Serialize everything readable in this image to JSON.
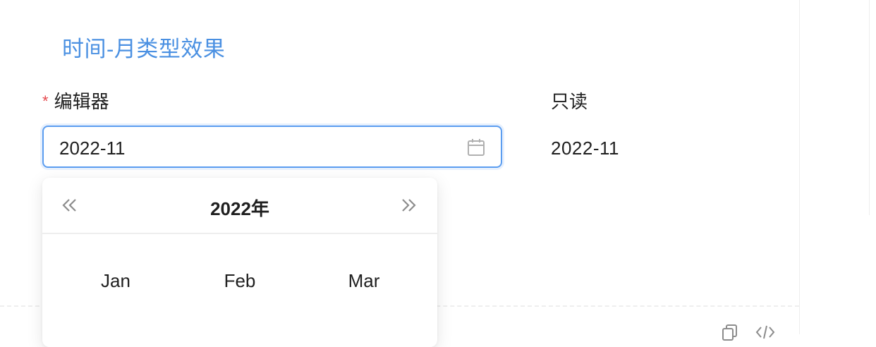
{
  "section": {
    "title": "时间-月类型效果"
  },
  "editor": {
    "required_mark": "*",
    "label": "编辑器",
    "value": "2022-11"
  },
  "readonly": {
    "label": "只读",
    "value": "2022-11"
  },
  "picker": {
    "year_title": "2022年",
    "months": [
      "Jan",
      "Feb",
      "Mar"
    ]
  },
  "icons": {
    "calendar": "calendar-icon",
    "prev": "double-chevron-left-icon",
    "next": "double-chevron-right-icon",
    "copy": "copy-icon",
    "code": "code-icon"
  },
  "colors": {
    "title": "#4a90e2",
    "focus_border": "#5b9df0",
    "required": "#e5484d"
  }
}
